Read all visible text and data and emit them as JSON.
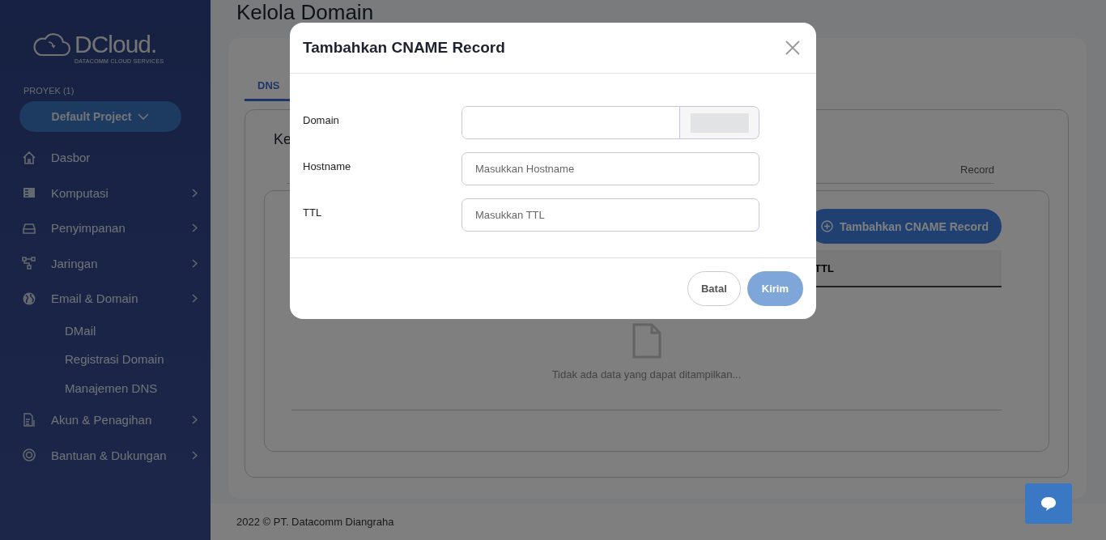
{
  "sidebar": {
    "logo": {
      "name": "DCloud.",
      "tagline": "DATACOMM CLOUD SERVICES"
    },
    "project_label": "PROYEK (1)",
    "project_button": "Default Project",
    "items": [
      {
        "label": "Dasbor",
        "kind": "home",
        "submenu": false
      },
      {
        "label": "Komputasi",
        "kind": "server",
        "submenu": true
      },
      {
        "label": "Penyimpanan",
        "kind": "drive",
        "submenu": true
      },
      {
        "label": "Jaringan",
        "kind": "network",
        "submenu": true
      },
      {
        "label": "Email & Domain",
        "kind": "globe",
        "submenu": true,
        "children": [
          {
            "label": "DMail"
          },
          {
            "label": "Registrasi Domain"
          },
          {
            "label": "Manajemen DNS"
          }
        ]
      },
      {
        "label": "Akun & Penagihan",
        "kind": "billing",
        "submenu": true
      },
      {
        "label": "Bantuan & Dukungan",
        "kind": "support",
        "submenu": true
      }
    ]
  },
  "main": {
    "title": "Kelola Domain",
    "tabs": [
      {
        "label": "DNS",
        "selected": true
      }
    ],
    "section_heading": "Ke",
    "record_tabs": [
      {
        "label": "Record"
      }
    ],
    "add_button": "Tambahkan CNAME Record",
    "table": {
      "columns": [
        "TTL"
      ]
    },
    "empty_message": "Tidak ada data yang dapat ditampilkan..."
  },
  "footer": "2022 © PT. Datacomm Diangraha",
  "modal": {
    "title": "Tambahkan CNAME Record",
    "fields": [
      {
        "label": "Domain",
        "kind": "addon"
      },
      {
        "label": "Hostname",
        "kind": "text",
        "placeholder": "Masukkan Hostname"
      },
      {
        "label": "TTL",
        "kind": "text",
        "placeholder": "Masukkan TTL"
      }
    ],
    "buttons": [
      {
        "label": "Batal",
        "kind": "secondary",
        "disabled": false
      },
      {
        "label": "Kirim",
        "kind": "primary",
        "disabled": true
      }
    ]
  }
}
